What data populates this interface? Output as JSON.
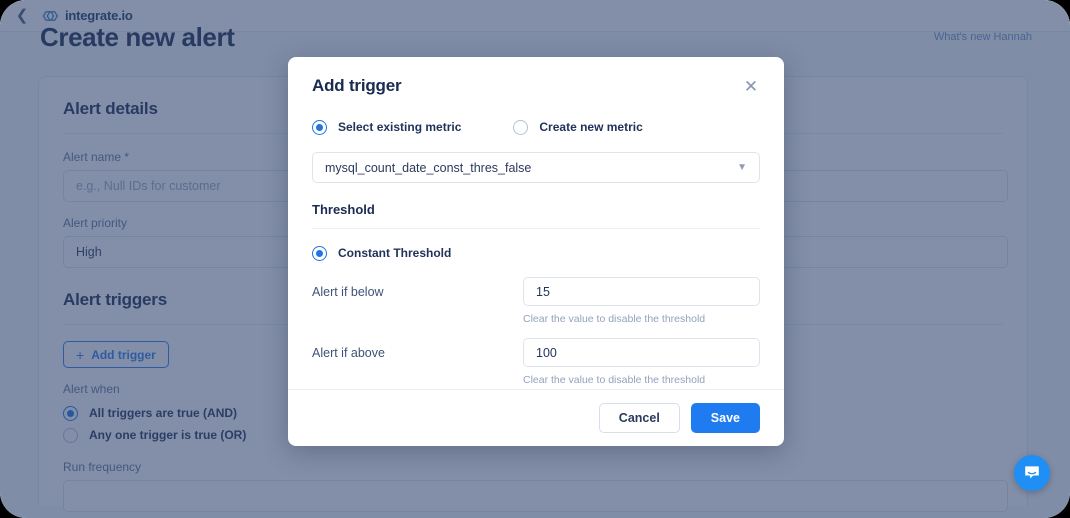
{
  "topbar": {
    "back_icon": "chevron-left-icon",
    "brand_name": "integrate.io"
  },
  "page": {
    "title": "Create new alert",
    "top_right_link": "What's new Hannah"
  },
  "alert_details": {
    "heading": "Alert details",
    "name_label": "Alert name *",
    "name_value": "",
    "name_placeholder": "e.g., Null IDs for customer",
    "priority_label": "Alert priority",
    "priority_value": "High"
  },
  "alert_triggers": {
    "heading": "Alert triggers",
    "add_trigger_label": "Add trigger",
    "add_trigger_icon": "plus-icon",
    "alert_when_label": "Alert when",
    "options": [
      {
        "label": "All triggers are true (AND)",
        "checked": true
      },
      {
        "label": "Any one trigger is true (OR)",
        "checked": false
      }
    ],
    "run_frequency_label": "Run frequency"
  },
  "modal": {
    "title": "Add trigger",
    "close_icon": "close-icon",
    "metric_mode": [
      {
        "label": "Select existing metric",
        "checked": true
      },
      {
        "label": "Create new metric",
        "checked": false
      }
    ],
    "metric_select_value": "mysql_count_date_const_thres_false",
    "metric_select_icon": "chevron-down-icon",
    "threshold_heading": "Threshold",
    "threshold_type": {
      "label": "Constant Threshold",
      "checked": true
    },
    "fields": [
      {
        "label": "Alert if below",
        "value": "15",
        "hint": "Clear the value to disable the threshold"
      },
      {
        "label": "Alert if above",
        "value": "100",
        "hint": "Clear the value to disable the threshold"
      }
    ],
    "cancel_label": "Cancel",
    "save_label": "Save"
  },
  "support": {
    "launcher_icon": "chat-bubble-icon"
  },
  "colors": {
    "accent": "#1f7cf0",
    "heading": "#1a2b52",
    "overlay": "#30446e"
  }
}
